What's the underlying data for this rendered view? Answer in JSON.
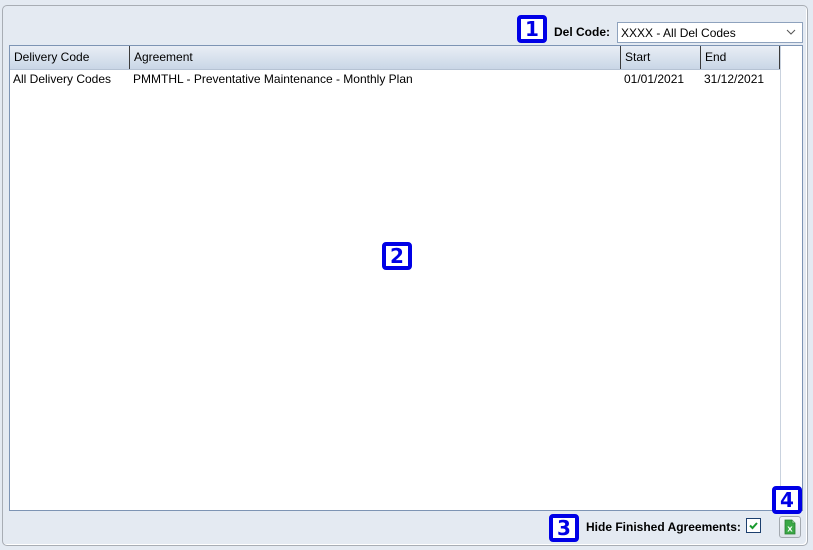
{
  "filter": {
    "label": "Del Code:",
    "selected": "XXXX - All Del Codes"
  },
  "table": {
    "columns": [
      "Delivery Code",
      "Agreement",
      "Start",
      "End"
    ],
    "rows": [
      {
        "delivery_code": "All Delivery Codes",
        "agreement": "PMMTHL - Preventative Maintenance - Monthly Plan",
        "start": "01/01/2021",
        "end": "31/12/2021"
      }
    ]
  },
  "footer": {
    "hide_finished_label": "Hide Finished Agreements:",
    "hide_finished_checked": true,
    "export_icon": "excel-export-icon"
  },
  "callouts": [
    "1",
    "2",
    "3",
    "4"
  ],
  "colors": {
    "callout": "#0000e6",
    "background": "#e4eaf2",
    "header_gradient_top": "#e9eef5",
    "header_gradient_bottom": "#c9d6e6",
    "check": "#1a9a2e",
    "excel_green": "#3aa845"
  }
}
